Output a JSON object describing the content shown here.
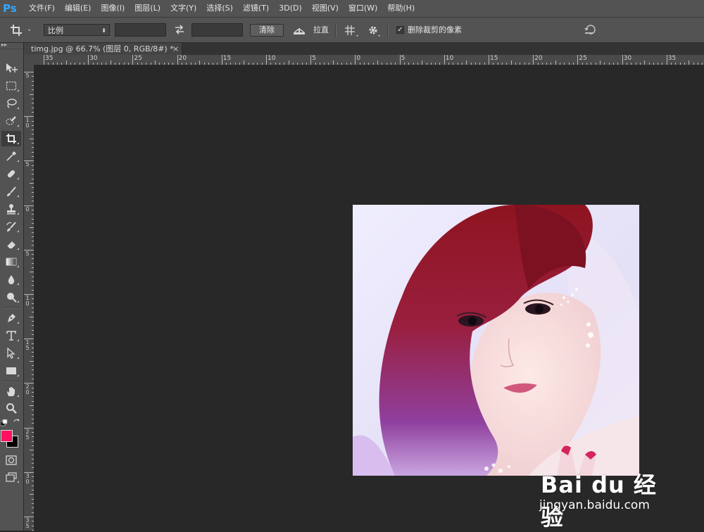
{
  "app": {
    "logo": "Ps"
  },
  "menu": [
    "文件(F)",
    "编辑(E)",
    "图像(I)",
    "图层(L)",
    "文字(Y)",
    "选择(S)",
    "滤镜(T)",
    "3D(D)",
    "视图(V)",
    "窗口(W)",
    "帮助(H)"
  ],
  "options": {
    "ratio_select": "比例",
    "width_value": "",
    "height_value": "",
    "clear_label": "清除",
    "straighten_label": "拉直",
    "delete_cropped_label": "删除裁剪的像素",
    "delete_cropped_checked": true
  },
  "document": {
    "tab_title": "timg.jpg @ 66.7% (图层 0, RGB/8#) *",
    "close": "×"
  },
  "ruler": {
    "h_labels": [
      "35",
      "30",
      "25",
      "20",
      "15",
      "10",
      "5",
      "0",
      "5",
      "10",
      "15",
      "20",
      "25",
      "30",
      "35"
    ],
    "v_labels": [
      "5",
      "1 0",
      "5",
      "0",
      "5",
      "1 0",
      "1 5",
      "2 0",
      "2 5",
      "3 0",
      "3 5"
    ]
  },
  "colors": {
    "foreground": "#ff1060",
    "background": "#000000",
    "accent": "#31a8ff"
  },
  "watermark": {
    "brand": "Bai du 经验",
    "url": "jingyan.baidu.com"
  }
}
